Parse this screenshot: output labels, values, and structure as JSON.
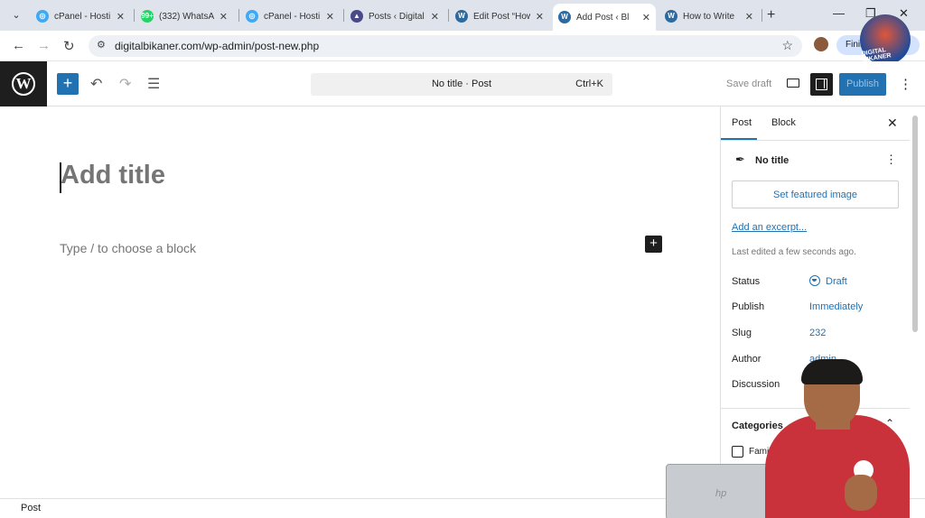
{
  "browser": {
    "tabs": [
      {
        "label": "cPanel - Hosti",
        "favicon": "cpanel-icon",
        "color": "#3fa9f5"
      },
      {
        "label": "(332) WhatsA",
        "favicon": "whatsapp-icon",
        "color": "#25d366",
        "badge": "99+"
      },
      {
        "label": "cPanel - Hosti",
        "favicon": "cpanel-icon",
        "color": "#3fa9f5"
      },
      {
        "label": "Posts ‹ Digital",
        "favicon": "rocket-icon",
        "color": "#4a4a8a"
      },
      {
        "label": "Edit Post “How",
        "favicon": "wordpress-icon",
        "color": "#2c6aa0"
      },
      {
        "label": "Add Post ‹ Bl",
        "favicon": "wordpress-icon",
        "color": "#2c6aa0",
        "active": true
      },
      {
        "label": "How to Write",
        "favicon": "wordpress-icon",
        "color": "#2c6aa0"
      }
    ],
    "url": "digitalbikaner.com/wp-admin/post-new.php",
    "finish_label": "Finis",
    "logo_text": "DIGITAL BIKANER"
  },
  "editor": {
    "command_title": "No title · Post",
    "command_shortcut": "Ctrl+K",
    "save_draft": "Save draft",
    "publish": "Publish",
    "title_placeholder": "Add title",
    "block_placeholder": "Type / to choose a block"
  },
  "sidebar": {
    "tabs": [
      "Post",
      "Block"
    ],
    "doc_title": "No title",
    "featured_image": "Set featured image",
    "excerpt": "Add an excerpt...",
    "last_edited": "Last edited a few seconds ago.",
    "meta": [
      {
        "label": "Status",
        "value": "Draft"
      },
      {
        "label": "Publish",
        "value": "Immediately"
      },
      {
        "label": "Slug",
        "value": "232"
      },
      {
        "label": "Author",
        "value": "admin"
      },
      {
        "label": "Discussion",
        "value": ""
      }
    ],
    "categories_heading": "Categories",
    "category_first": "Family"
  },
  "footer": {
    "breadcrumb": "Post"
  },
  "colors": {
    "accent": "#2271b1",
    "dark": "#1e1e1e"
  }
}
